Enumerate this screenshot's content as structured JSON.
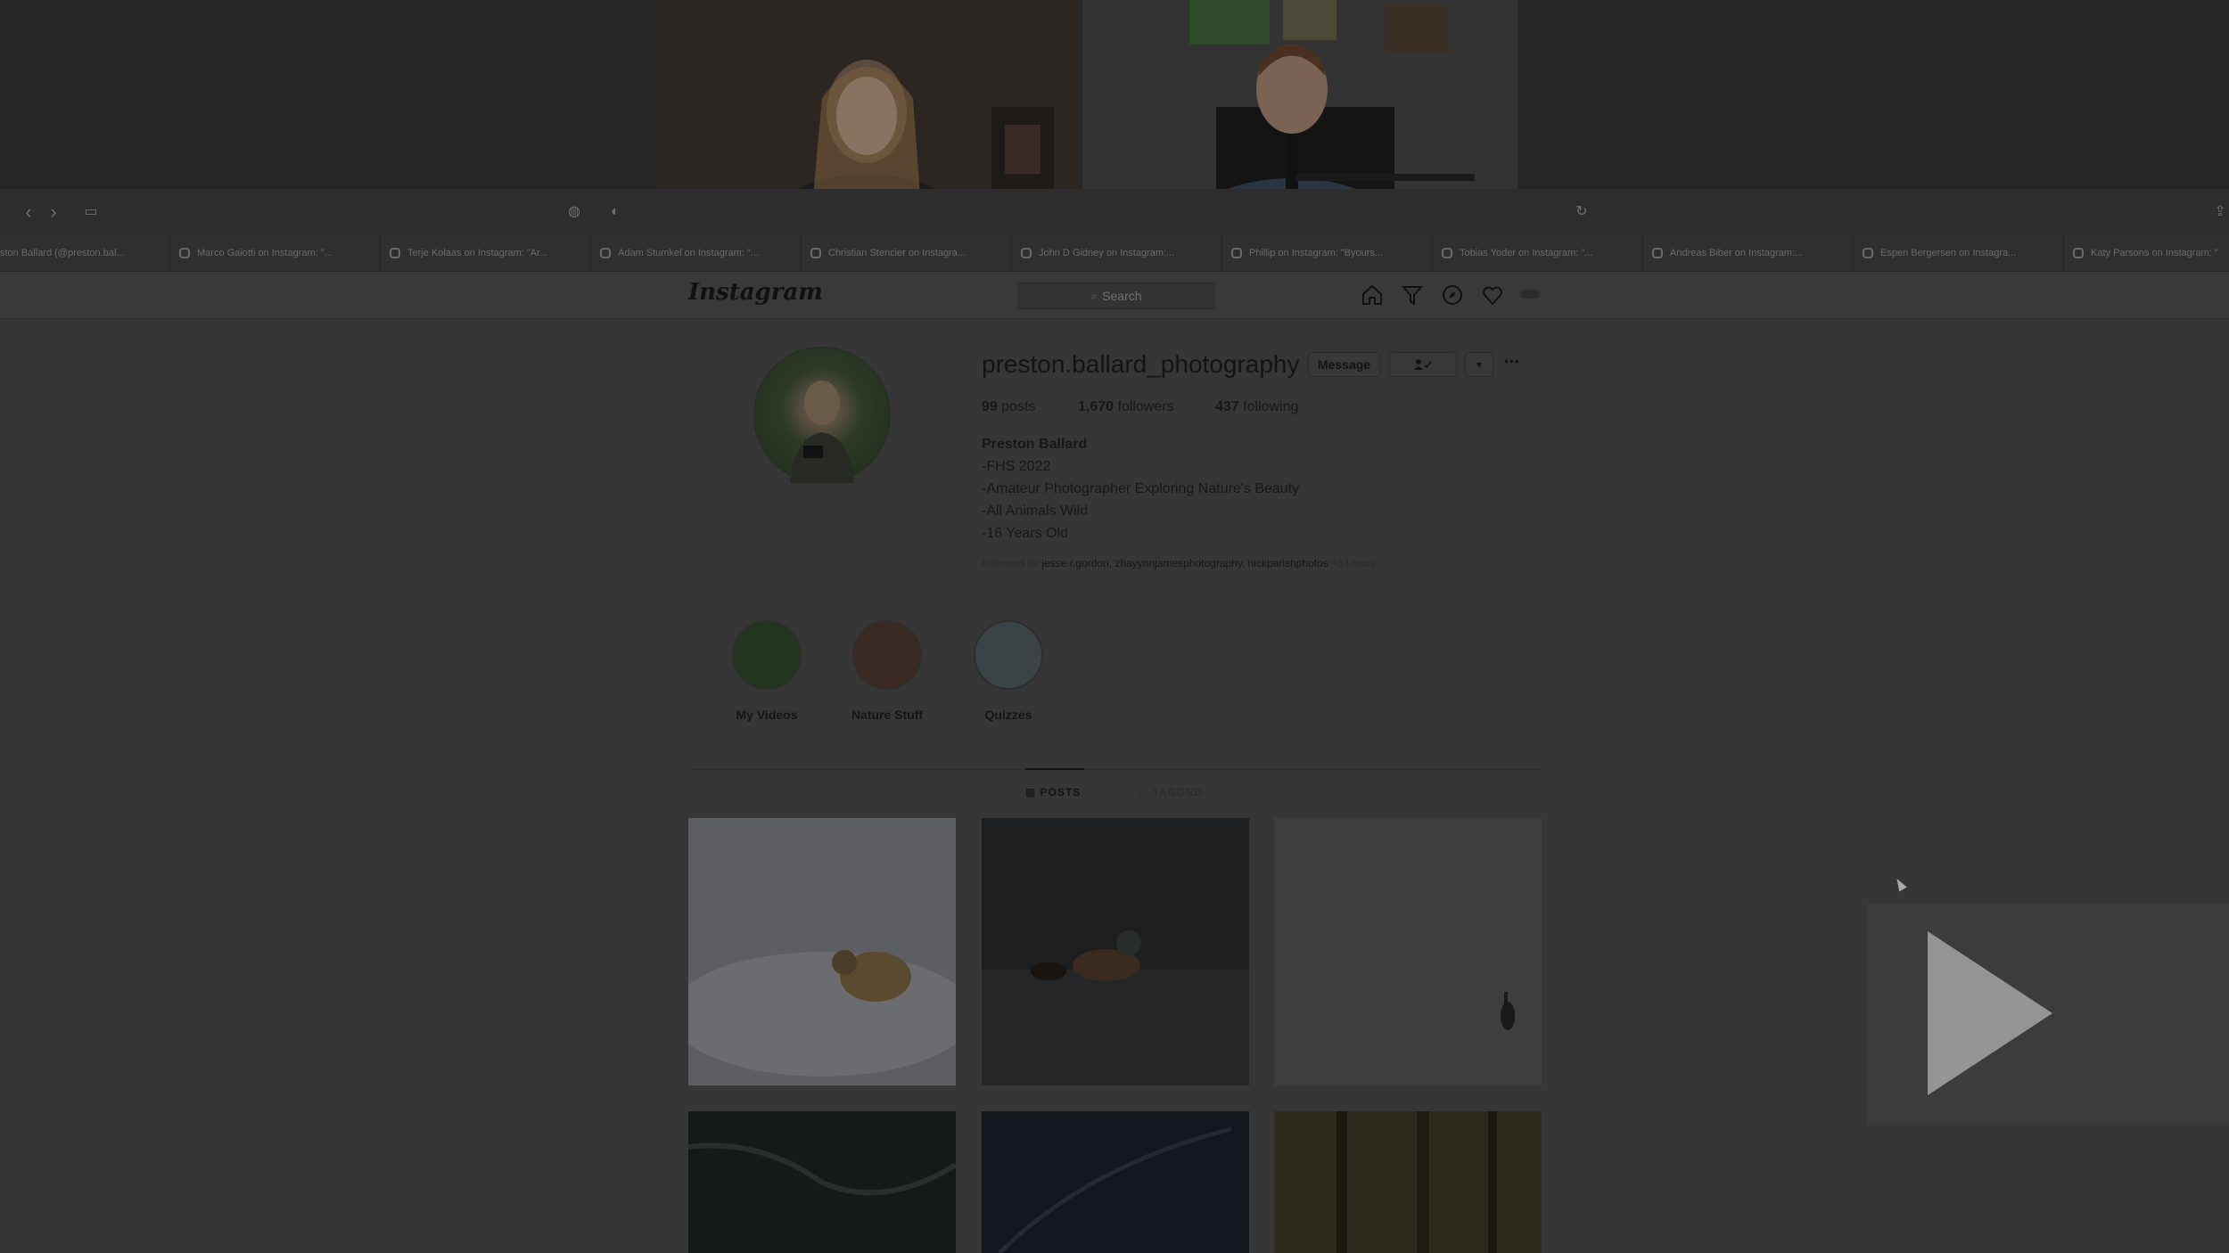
{
  "browser_tabs": [
    "ston Ballard (@preston.bal...",
    "Marco Gaiotti on Instagram: \"...",
    "Terje Kolaas on Instagram: \"Ar...",
    "Adam Stumkel on Instagram: \"...",
    "Christian Stencier on Instagra...",
    "John D Gidney on Instagram:...",
    "Phillip on Instagram: \"Byours...",
    "Tobias Yoder on Instagram: \"...",
    "Andreas Biber on Instagram:...",
    "Espen Bergersen on Instagra...",
    "Katy Parsons on Instagram: \""
  ],
  "header": {
    "logo": "Instagram",
    "search_placeholder": "Search"
  },
  "profile": {
    "username": "preston.ballard_photography",
    "message_label": "Message",
    "follow_icon": "▾",
    "more_icon": "•••",
    "posts_count": "99",
    "posts_label": " posts",
    "followers_count": "1,670",
    "followers_label": " followers",
    "following_count": "437",
    "following_label": " following",
    "name": "Preston Ballard",
    "bio": [
      "-FHS 2022",
      "-Amateur Photographer Exploring Nature's Beauty",
      "-All Animals Wild",
      "-16 Years Old"
    ],
    "followed_by_prefix": "Followed by ",
    "followed_by_users": "jesse.r.gordon, zhayynnjamesphotography, nickparishphotos",
    "followed_by_more": " +64 more"
  },
  "highlights": [
    {
      "label": "My Videos",
      "color": "#23351f"
    },
    {
      "label": "Nature Stuff",
      "color": "#3a2a23"
    },
    {
      "label": "Quizzes",
      "color": "#3c4346"
    }
  ],
  "tabs": {
    "posts": "POSTS",
    "tagged": "TAGGED"
  },
  "colors": {
    "accent_dark": "#141414",
    "page_bg": "#363636"
  }
}
